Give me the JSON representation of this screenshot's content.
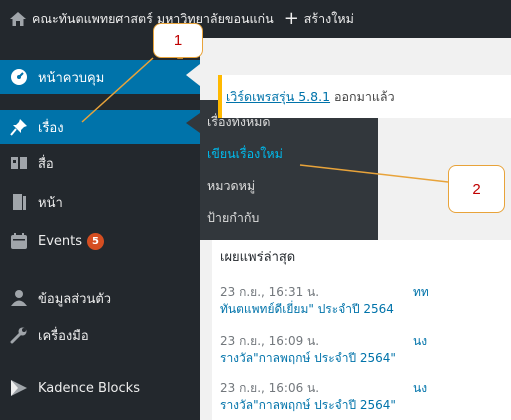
{
  "admin_bar": {
    "site_name": "คณะทันตแพทยศาสตร์ มหาวิทยาลัยขอนแก่น",
    "new_label": "สร้างใหม่"
  },
  "sidebar": {
    "items": [
      {
        "label": "หน้าควบคุม",
        "icon": "dashboard-icon"
      },
      {
        "label": "เรื่อง",
        "icon": "pin-icon"
      },
      {
        "label": "สื่อ",
        "icon": "media-icon"
      },
      {
        "label": "หน้า",
        "icon": "page-icon"
      },
      {
        "label": "Events",
        "icon": "calendar-icon",
        "badge": "5"
      },
      {
        "label": "ข้อมูลส่วนตัว",
        "icon": "user-icon"
      },
      {
        "label": "เครื่องมือ",
        "icon": "wrench-icon"
      },
      {
        "label": "Kadence Blocks",
        "icon": "kadence-icon"
      }
    ]
  },
  "submenu": {
    "items": [
      "เรื่องทั้งหมด",
      "เขียนเรื่องใหม่",
      "หมวดหมู่",
      "ป้ายกำกับ"
    ]
  },
  "notice": {
    "link": "เวิร์ดเพรสรุ่น 5.8.1",
    "text": "ออกมาแล้ว"
  },
  "activity": {
    "title": "เผยแพร่ล่าสุด",
    "rows": [
      {
        "time": "23 ก.ย., 16:31 น.",
        "right": "ทท",
        "line2": "ทันตแพทย์ดีเยี่ยม\" ประจำปี 2564"
      },
      {
        "time": "23 ก.ย., 16:09 น.",
        "right": "นง",
        "line2": "รางวัล\"กาลพฤกษ์ ประจำปี 2564\""
      },
      {
        "time": "23 ก.ย., 16:06 น.",
        "right": "นง",
        "line2": "รางวัล\"กาลพฤกษ์ ประจำปี 2564\""
      }
    ]
  },
  "callouts": {
    "one": "1",
    "two": "2"
  },
  "colors": {
    "admin_bg": "#23282d",
    "accent": "#0073aa",
    "submenu_bg": "#32373c",
    "callout_border": "#e8a33a",
    "callout_text": "#c00000",
    "badge": "#d54e21"
  }
}
